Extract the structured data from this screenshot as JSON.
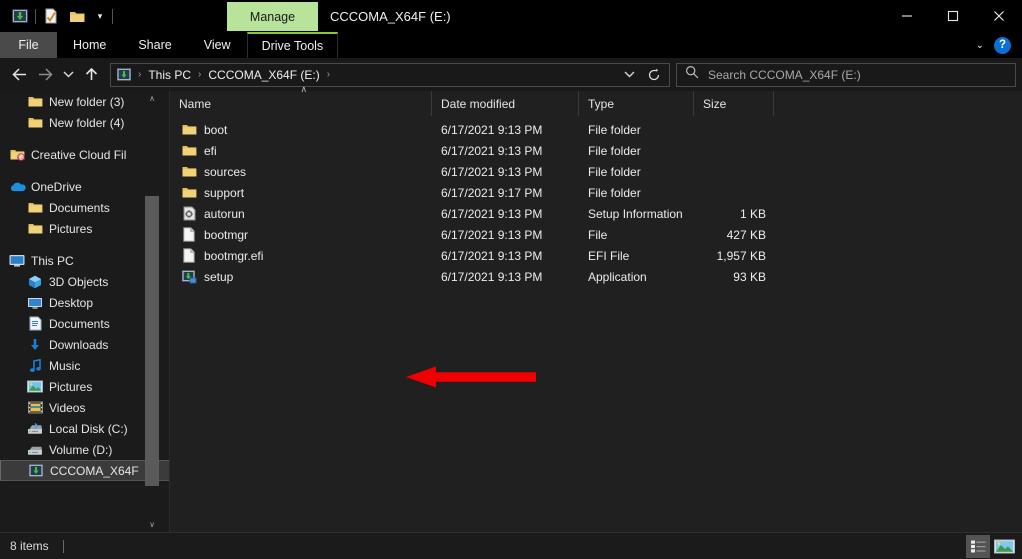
{
  "titlebar": {
    "quick_access": [
      {
        "name": "save-drive-icon",
        "label": "Save"
      },
      {
        "name": "properties-icon",
        "label": "Properties"
      },
      {
        "name": "new-folder-icon",
        "label": "New folder"
      }
    ],
    "customize_chevron": "▾",
    "manage_tab_label": "Manage",
    "manage_tab_color": "#b7e39b",
    "window_title": "CCCOMA_X64F (E:)",
    "minimize": "—",
    "maximize": "☐",
    "close": "✕"
  },
  "ribbon": {
    "tabs": [
      {
        "label": "File",
        "active": true
      },
      {
        "label": "Home",
        "active": false
      },
      {
        "label": "Share",
        "active": false
      },
      {
        "label": "View",
        "active": false
      },
      {
        "label": "Drive Tools",
        "active": false,
        "contextual": true
      }
    ],
    "collapse_chevron": "⌄",
    "help_label": "?"
  },
  "address": {
    "back_icon": "←",
    "forward_icon": "→",
    "recent_icon": "⌄",
    "up_icon": "↑",
    "breadcrumbs": [
      "This PC",
      "CCCOMA_X64F (E:)"
    ],
    "separator": "›",
    "dropdown_icon": "⌄",
    "refresh_icon": "↻",
    "search_placeholder": "Search CCCOMA_X64F (E:)"
  },
  "sidebar": {
    "items": [
      {
        "label": "New folder (3)",
        "icon": "folder-icon",
        "indent": 1
      },
      {
        "label": "New folder (4)",
        "icon": "folder-icon",
        "indent": 1
      },
      {
        "label": "Creative Cloud Fil",
        "icon": "creative-cloud-icon",
        "indent": 0,
        "gap_before": true
      },
      {
        "label": "OneDrive",
        "icon": "onedrive-icon",
        "indent": 0,
        "gap_before": true
      },
      {
        "label": "Documents",
        "icon": "folder-icon",
        "indent": 1
      },
      {
        "label": "Pictures",
        "icon": "folder-icon",
        "indent": 1
      },
      {
        "label": "This PC",
        "icon": "this-pc-icon",
        "indent": 0,
        "gap_before": true
      },
      {
        "label": "3D Objects",
        "icon": "3d-objects-icon",
        "indent": 1
      },
      {
        "label": "Desktop",
        "icon": "desktop-icon",
        "indent": 1
      },
      {
        "label": "Documents",
        "icon": "documents-icon",
        "indent": 1
      },
      {
        "label": "Downloads",
        "icon": "downloads-icon",
        "indent": 1
      },
      {
        "label": "Music",
        "icon": "music-icon",
        "indent": 1
      },
      {
        "label": "Pictures",
        "icon": "pictures-icon",
        "indent": 1
      },
      {
        "label": "Videos",
        "icon": "videos-icon",
        "indent": 1
      },
      {
        "label": "Local Disk (C:)",
        "icon": "local-disk-icon",
        "indent": 1
      },
      {
        "label": "Volume (D:)",
        "icon": "volume-disk-icon",
        "indent": 1
      },
      {
        "label": "CCCOMA_X64F",
        "icon": "optical-drive-icon",
        "indent": 1,
        "selected": true
      }
    ],
    "scroll_up": "∧",
    "scroll_down": "∨"
  },
  "filelist": {
    "columns": [
      {
        "label": "Name",
        "sorted": "asc"
      },
      {
        "label": "Date modified"
      },
      {
        "label": "Type"
      },
      {
        "label": "Size"
      }
    ],
    "sort_caret": "∧",
    "rows": [
      {
        "name": "boot",
        "icon": "folder-icon",
        "date": "6/17/2021 9:13 PM",
        "type": "File folder",
        "size": ""
      },
      {
        "name": "efi",
        "icon": "folder-icon",
        "date": "6/17/2021 9:13 PM",
        "type": "File folder",
        "size": ""
      },
      {
        "name": "sources",
        "icon": "folder-icon",
        "date": "6/17/2021 9:13 PM",
        "type": "File folder",
        "size": ""
      },
      {
        "name": "support",
        "icon": "folder-icon",
        "date": "6/17/2021 9:17 PM",
        "type": "File folder",
        "size": ""
      },
      {
        "name": "autorun",
        "icon": "setup-info-icon",
        "date": "6/17/2021 9:13 PM",
        "type": "Setup Information",
        "size": "1 KB"
      },
      {
        "name": "bootmgr",
        "icon": "generic-file-icon",
        "date": "6/17/2021 9:13 PM",
        "type": "File",
        "size": "427 KB"
      },
      {
        "name": "bootmgr.efi",
        "icon": "generic-file-icon",
        "date": "6/17/2021 9:13 PM",
        "type": "EFI File",
        "size": "1,957 KB"
      },
      {
        "name": "setup",
        "icon": "application-icon",
        "date": "6/17/2021 9:13 PM",
        "type": "Application",
        "size": "93 KB"
      }
    ]
  },
  "annotation": {
    "name": "red-arrow-pointing-to-setup",
    "color": "#f00000",
    "points_to": "setup"
  },
  "statusbar": {
    "item_count": "8 items",
    "view_details_label": "Details view",
    "view_large_label": "Large icons view"
  }
}
